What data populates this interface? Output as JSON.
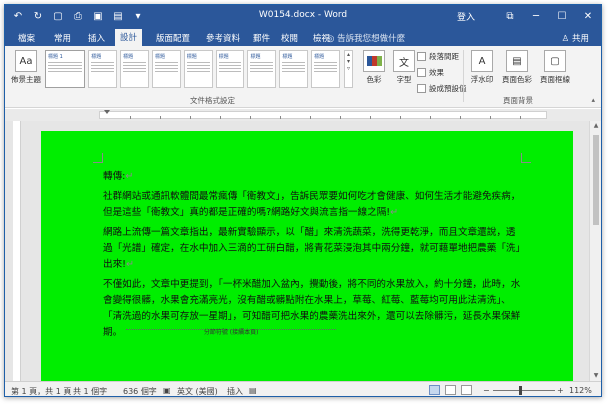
{
  "titlebar": {
    "doc_title": "W0154.docx - Word",
    "signin": "登入",
    "qat_icons": [
      "save-icon",
      "undo-icon",
      "redo-icon",
      "new-doc-icon",
      "open-icon",
      "print-preview-icon",
      "customize-icon"
    ],
    "window_controls": [
      "ribbon-display-icon",
      "minimize-icon",
      "maximize-icon",
      "close-icon"
    ]
  },
  "tabs": {
    "items": [
      {
        "label": "檔案"
      },
      {
        "label": "常用"
      },
      {
        "label": "插入"
      },
      {
        "label": "設計"
      },
      {
        "label": "版面配置"
      },
      {
        "label": "參考資料"
      },
      {
        "label": "郵件"
      },
      {
        "label": "校閱"
      },
      {
        "label": "檢視"
      }
    ],
    "active": "設計",
    "tell_me": "告訴我您想做什麼",
    "share": "共用"
  },
  "ribbon": {
    "theme_label": "佈景主題",
    "style_thumbs": [
      {
        "title": "標題 1"
      },
      {
        "title": "標題"
      },
      {
        "title": "標題"
      },
      {
        "title": "標題"
      },
      {
        "title": "標題"
      },
      {
        "title": "標題"
      },
      {
        "title": "標題"
      },
      {
        "title": "標題"
      },
      {
        "title": "標題"
      }
    ],
    "group_doc_format": "文件格式設定",
    "colors_label": "色彩",
    "fonts_label": "字型",
    "paragraph_spacing": "段落間距",
    "effects": "效果",
    "set_default": "設成預設值",
    "watermark": "浮水印",
    "page_color": "頁面色彩",
    "page_borders": "頁面框線",
    "group_page_background": "頁面背景"
  },
  "document": {
    "page_color": "#00ee00",
    "heading": "轉傳:",
    "para1": "社群網站或通訊軟體間最常瘋傳「衛教文」，告訴民眾要如何吃才會健康、如何生活才能避免疾病，但是這些「衛教文」真的都是正確的嗎?網路好文與流言指一線之隔!",
    "para2": "網路上流傳一篇文章指出，最新實驗顯示，以「醋」來清洗蔬菜，洗得更乾淨，而且文章還說，透過「光譜」確定，在水中加入三滴的工研白醋，將青花菜浸泡其中兩分鐘，就可藉單地把農藥「洗」出來!",
    "para3": "不僅如此，文章中更提到，「一杯米醋加入盆內，攪動後，將不同的水果放入，約十分鐘，此時，水會變得很髒，水果會充滿亮光，沒有醋或髒點附在水果上，草莓、紅莓、藍莓均可用此法清洗」、「清洗過的水果可存放一星期」，可知醋可把水果的農藥洗出來外，還可以去除髒污，延長水果保鮮期。",
    "page_break": "分節符號 (接續本頁)"
  },
  "status": {
    "page": "第 1 頁，共 1 頁",
    "words": "共 1 個字",
    "chars": "636 個字",
    "lang": "英文 (美國)",
    "insert": "插入",
    "zoom": "112%"
  }
}
